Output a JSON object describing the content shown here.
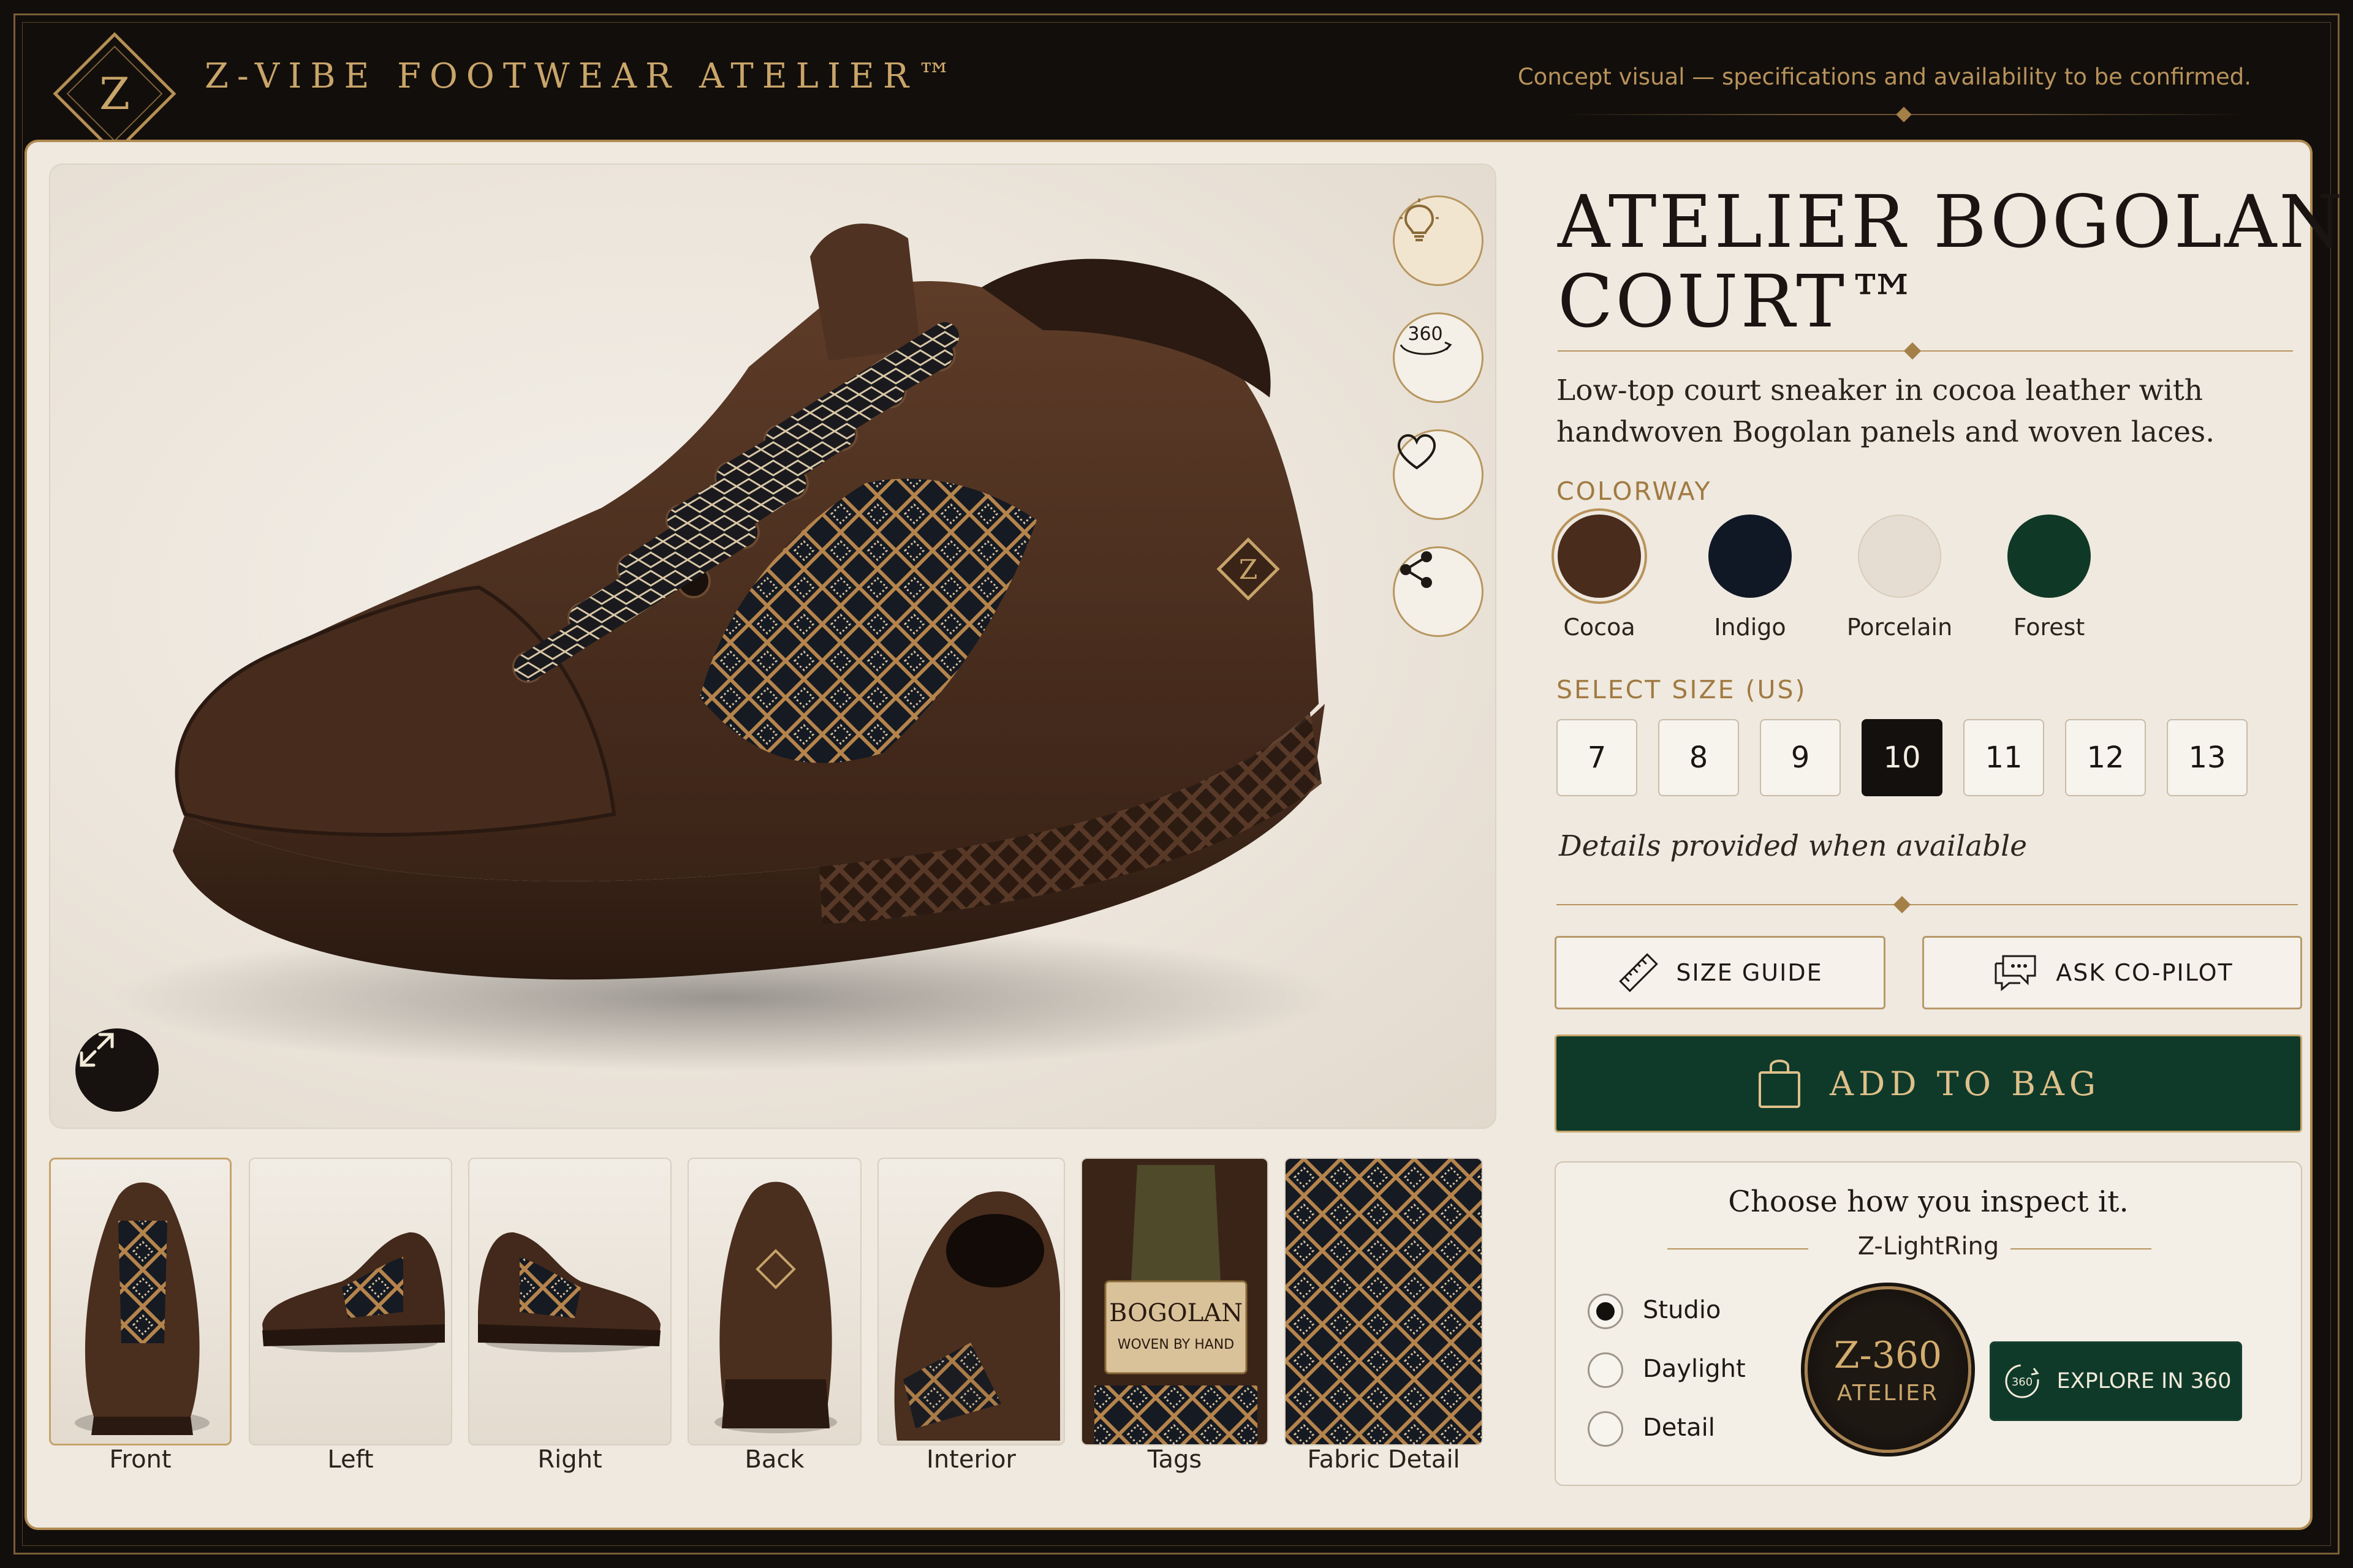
{
  "header": {
    "logo_letter": "Z",
    "brand": "Z-VIBE FOOTWEAR ATELIER™",
    "notice": "Concept visual — specifications and availability to be confirmed."
  },
  "hero": {
    "tongue_badge": "Z",
    "actions": [
      {
        "name": "lighting",
        "icon": "lightbulb-icon"
      },
      {
        "name": "view-360",
        "icon": "rotate-360-icon",
        "label": "360"
      },
      {
        "name": "wishlist",
        "icon": "heart-icon"
      },
      {
        "name": "share",
        "icon": "share-icon"
      }
    ],
    "expand_icon": "expand-icon"
  },
  "thumbnails": [
    {
      "label": "Front",
      "active": true
    },
    {
      "label": "Left"
    },
    {
      "label": "Right"
    },
    {
      "label": "Back"
    },
    {
      "label": "Interior"
    },
    {
      "label": "Tags",
      "tag_line1": "BOGOLAN",
      "tag_line2": "WOVEN BY HAND"
    },
    {
      "label": "Fabric Detail"
    }
  ],
  "product": {
    "title_line1": "ATELIER BOGOLAN",
    "title_line2": "COURT™",
    "description": "Low-top court sneaker in cocoa leather with handwoven Bogolan panels and woven laces.",
    "colorway_label": "COLORWAY",
    "colorways": [
      {
        "name": "Cocoa",
        "hex": "#4a2c1c",
        "selected": true
      },
      {
        "name": "Indigo",
        "hex": "#101826"
      },
      {
        "name": "Porcelain",
        "hex": "#e6ddd2"
      },
      {
        "name": "Forest",
        "hex": "#103826"
      }
    ],
    "size_label": "SELECT SIZE (US)",
    "sizes": [
      "7",
      "8",
      "9",
      "10",
      "11",
      "12",
      "13"
    ],
    "selected_size": "10",
    "details_note": "Details provided when available",
    "size_guide": "SIZE GUIDE",
    "ask_copilot": "ASK CO-PILOT",
    "add_to_bag": "ADD TO BAG"
  },
  "inspect": {
    "heading": "Choose how you inspect it.",
    "subheading": "Z-LightRing",
    "modes": [
      {
        "label": "Studio",
        "selected": true
      },
      {
        "label": "Daylight"
      },
      {
        "label": "Detail"
      }
    ],
    "badge_line1": "Z-360",
    "badge_line2": "ATELIER",
    "explore_icon_text": "360",
    "explore": "EXPLORE IN 360"
  },
  "colors": {
    "accent_gold": "#b8935b",
    "forest_green": "#0f3a2a",
    "dark": "#14100d",
    "card": "#efe9df"
  }
}
